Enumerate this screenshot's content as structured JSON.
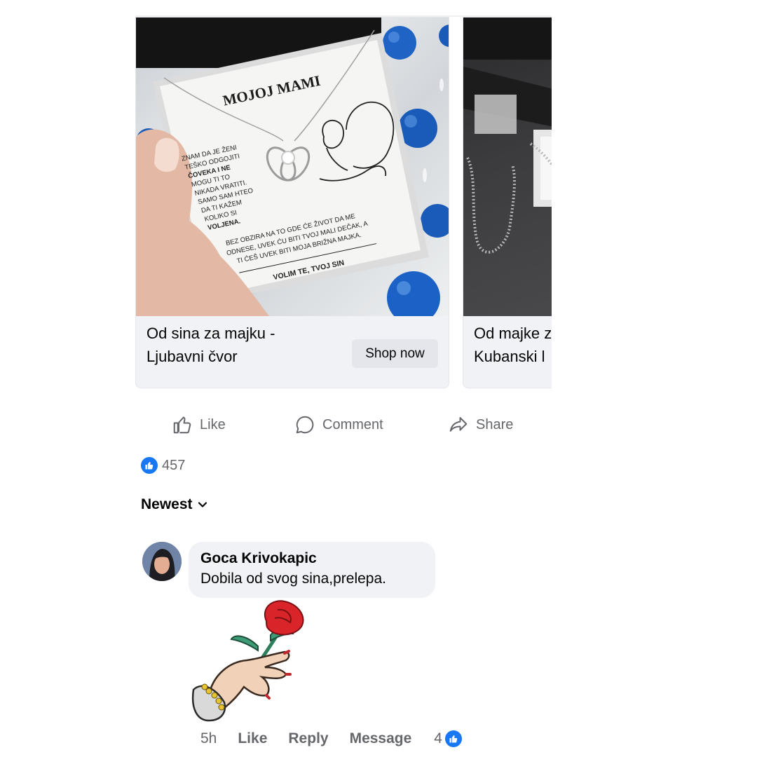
{
  "carousel": {
    "cards": [
      {
        "title_line1": "Od sina za majku -",
        "title_line2": "Ljubavni čvor",
        "cta": "Shop now",
        "photo": {
          "heading": "MOJOJ MAMI",
          "left_text": [
            "ZNAM DA JE ŽENI",
            "TEŠKO ODGOJITI",
            "ČOVEKA I NE",
            "MOGU TI TO",
            "NIKADA VRATITI.",
            "SAMO SAM HTEO",
            "DA TI KAŽEM",
            "KOLIKO SI",
            "VOLJENA."
          ],
          "bottom_text": [
            "BEZ OBZIRA NA TO GDE ĆE ŽIVOT DA ME",
            "ODNESE, UVEK ĆU BITI TVOJ MALI DEČAK, A",
            "TI ĆEŠ UVEK BITI MOJA BRIŽNA MAJKA."
          ],
          "signature": "VOLIM TE, TVOJ SIN"
        }
      },
      {
        "title_line1": "Od majke z",
        "title_line2": "Kubanski l"
      }
    ]
  },
  "actions": {
    "like": "Like",
    "comment": "Comment",
    "share": "Share"
  },
  "reactions": {
    "count": "457"
  },
  "sort": {
    "label": "Newest"
  },
  "comment": {
    "author": "Goca Krivokapic",
    "text": "Dobila od svog sina,prelepa.",
    "time": "5h",
    "like": "Like",
    "reply": "Reply",
    "message": "Message",
    "reaction_count": "4"
  },
  "colors": {
    "facebook_blue": "#1877f2",
    "muted": "#65676b",
    "bubble": "#f0f2f5",
    "ornament_blue": "#1f6fd0"
  }
}
